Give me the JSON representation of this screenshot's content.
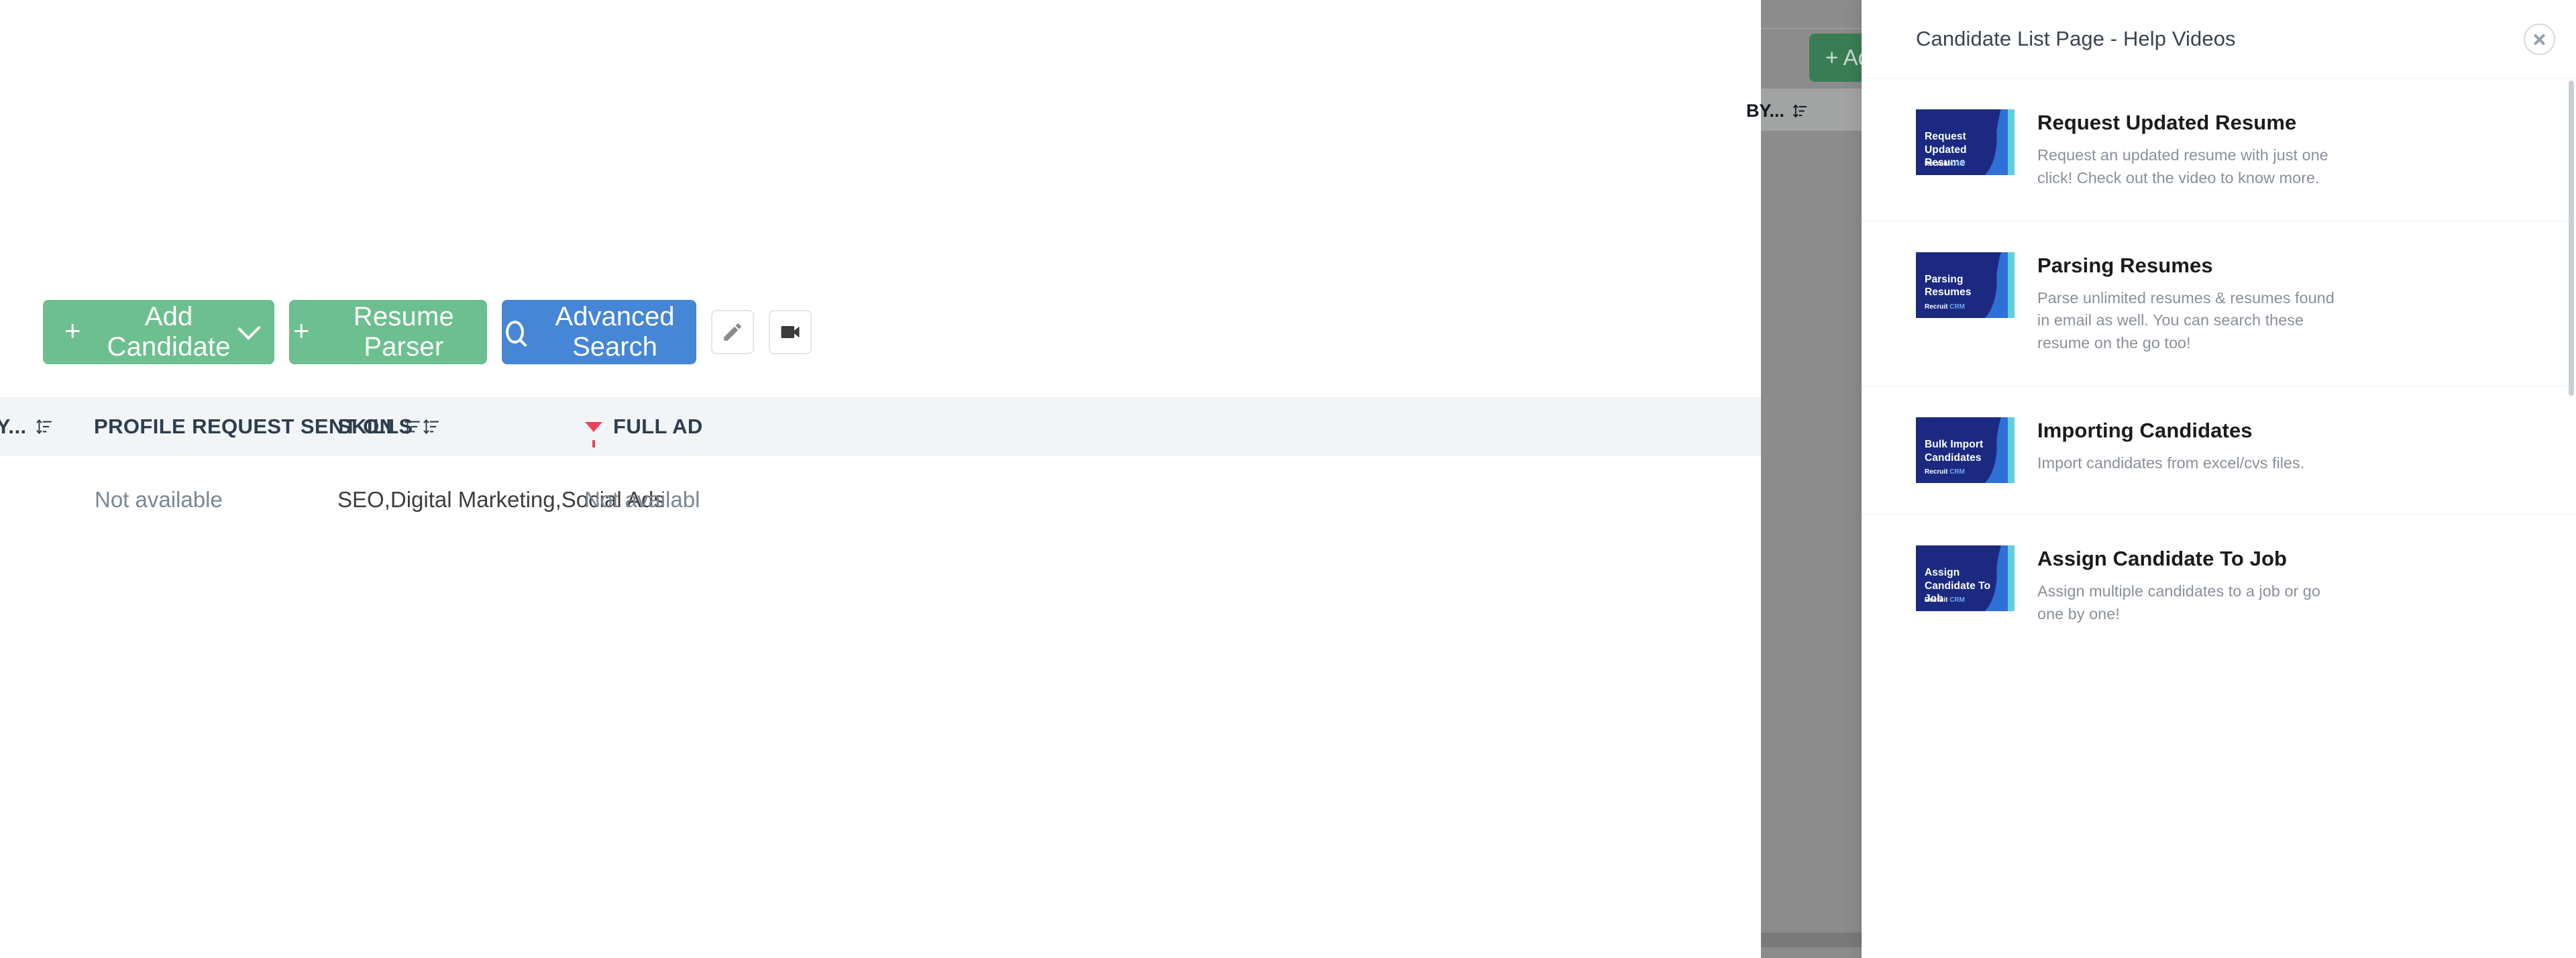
{
  "app": {
    "toolbar": {
      "add_candidate": {
        "label": "Add Candidate",
        "plus": "+",
        "dropdown_icon": "chevron-down-icon"
      },
      "resume_parser": {
        "label": "Resume Parser",
        "plus": "+"
      },
      "advanced_search": {
        "label": "Advanced Search",
        "icon": "search-icon"
      },
      "edit_button": {
        "icon": "pencil-icon"
      },
      "video_button": {
        "icon": "video-camera-icon"
      }
    },
    "table": {
      "columns": [
        {
          "label": "BY...",
          "sort_icon": "sort-icon",
          "filtered": false
        },
        {
          "label": "PROFILE REQUEST SENT ON",
          "sort_icon": "sort-icon",
          "filtered": false
        },
        {
          "label": "SKILLS",
          "sort_icon": "sort-icon",
          "filtered": false
        },
        {
          "label": "FULL AD",
          "sort_icon": "",
          "filtered": true,
          "filter_icon": "filter-icon"
        }
      ],
      "rows": [
        {
          "profile_request_sent_on": "Not available",
          "skills": "SEO,Digital Marketing,Social Ads",
          "full_address": "Not availabl"
        }
      ]
    }
  },
  "dimmed_background": {
    "add_button_label": "+ Add",
    "column_label": "BY...",
    "sort_icon": "sort-icon"
  },
  "help_panel": {
    "title": "Candidate List Page - Help Videos",
    "close_icon": "close-icon",
    "brand_primary": "Recruit",
    "brand_secondary": "CRM",
    "videos": [
      {
        "thumb_title": "Request Updated Resume",
        "title": "Request Updated Resume",
        "description": "Request an updated resume with just one click! Check out the video to know more."
      },
      {
        "thumb_title": "Parsing Resumes",
        "title": "Parsing Resumes",
        "description": "Parse unlimited resumes & resumes found in email as well. You can search these resume on the go too!"
      },
      {
        "thumb_title": "Bulk Import Candidates",
        "title": "Importing Candidates",
        "description": "Import candidates from excel/cvs files."
      },
      {
        "thumb_title": "Assign Candidate To Job",
        "title": "Assign Candidate To Job",
        "description": "Assign multiple candidates to a job or go one by one!"
      }
    ]
  },
  "colors": {
    "green": "#6cbf8e",
    "blue": "#4586d6",
    "filter_red": "#ef4056",
    "thumb_navy": "#1b2a80",
    "thumb_wave_blue": "#2f6fd8",
    "thumb_wave_cyan": "#5ecfdc",
    "table_header_bg": "#f2f5f8"
  }
}
